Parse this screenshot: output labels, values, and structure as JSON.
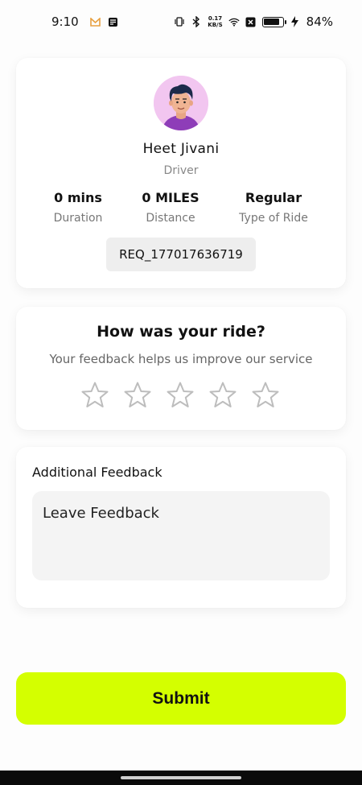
{
  "status_bar": {
    "time": "9:10",
    "net_speed_value": "0.17",
    "net_speed_unit": "KB/S",
    "battery_percent": "84%",
    "battery_level": 0.84
  },
  "driver": {
    "name": "Heet Jivani",
    "role": "Driver",
    "stats": [
      {
        "value": "0 mins",
        "label": "Duration"
      },
      {
        "value": "0 MILES",
        "label": "Distance"
      },
      {
        "value": "Regular",
        "label": "Type of Ride"
      }
    ],
    "request_id": "REQ_177017636719"
  },
  "rating": {
    "title": "How was your ride?",
    "subtitle": "Your feedback helps us improve our service",
    "max_stars": 5,
    "selected_stars": 0,
    "star_icon": "star-outline-icon"
  },
  "feedback": {
    "label": "Additional Feedback",
    "placeholder": "Leave Feedback",
    "value": ""
  },
  "submit": {
    "label": "Submit"
  },
  "colors": {
    "accent": "#d4ff00",
    "avatar_bg": "#f2c6f0",
    "star_outline": "#bdbdbd"
  }
}
